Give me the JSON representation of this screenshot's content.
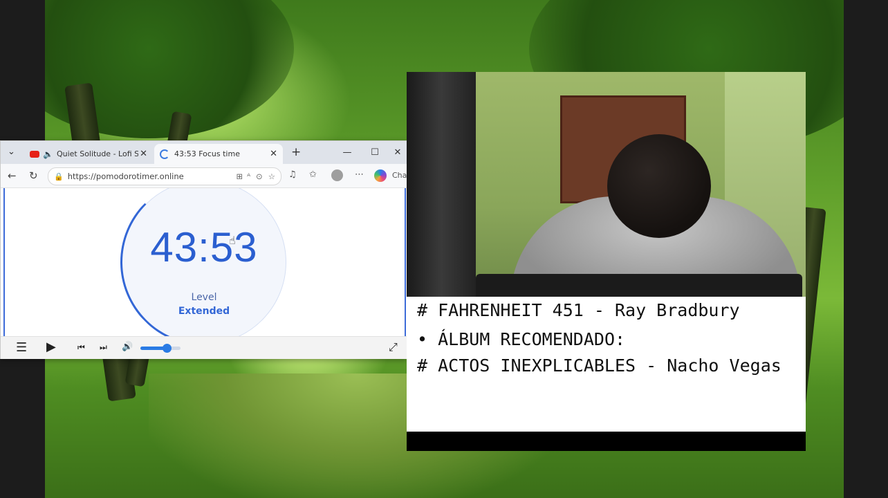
{
  "browser": {
    "tabs": [
      {
        "label": "Quiet Solitude - Lofi Son",
        "icon": "youtube-icon",
        "active": false,
        "muted_audio": true
      },
      {
        "label": "43:53 Focus time",
        "icon": "loading-spinner-icon",
        "active": true
      }
    ],
    "url": "https://pomodorotimer.online",
    "sidebar_partial_label": "Cha"
  },
  "timer": {
    "display": "43:53",
    "level_label": "Level",
    "level_value": "Extended",
    "accent_color": "#3367d6"
  },
  "player": {
    "volume_fraction": 0.65,
    "accent_color": "#2a7be4"
  },
  "notes": {
    "line1": "# FAHRENHEIT 451 - Ray Bradbury",
    "line2": "ÁLBUM RECOMENDADO:",
    "line3": "# ACTOS INEXPLICABLES - Nacho Vegas"
  }
}
